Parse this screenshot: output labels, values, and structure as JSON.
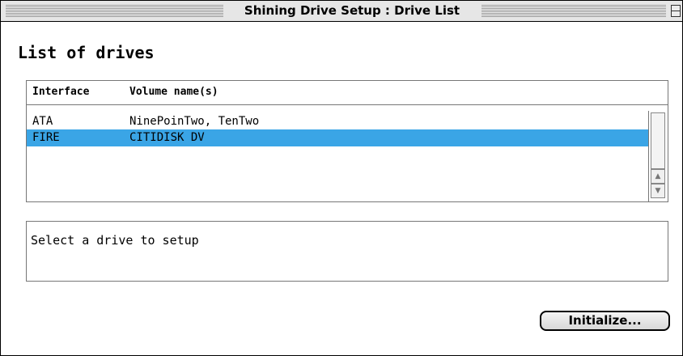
{
  "window": {
    "title": "Shining Drive Setup : Drive List"
  },
  "heading": "List of drives",
  "drive_list": {
    "columns": [
      "Interface",
      "Volume name(s)"
    ],
    "rows": [
      {
        "interface": "ATA",
        "volumes": "NinePoinTwo, TenTwo",
        "selected": false
      },
      {
        "interface": "FIRE",
        "volumes": "CITIDISK DV",
        "selected": true
      }
    ],
    "scroll_up_icon": "triangle-up",
    "scroll_down_icon": "triangle-down"
  },
  "message": "Select a drive to setup",
  "buttons": {
    "initialize_label": "Initialize..."
  },
  "colors": {
    "selection": "#3aa5e6"
  }
}
